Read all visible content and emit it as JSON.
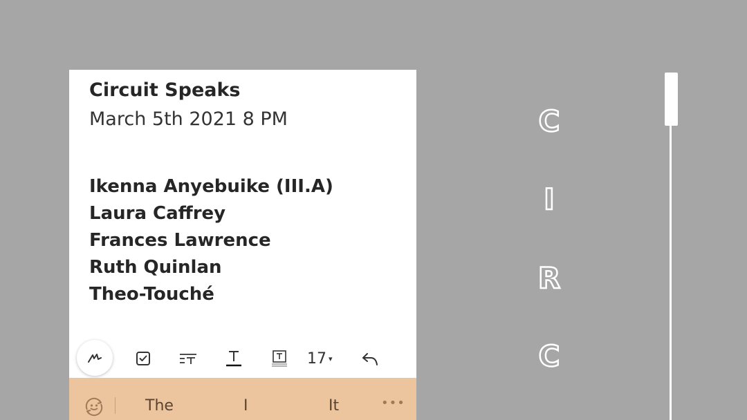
{
  "note": {
    "title": "Circuit Speaks",
    "date": "March 5th 2021 8 PM",
    "names": [
      "Ikenna Anyebuike (III.A)",
      "Laura Caffrey",
      "Frances Lawrence",
      "Ruth Quinlan",
      "Theo-Touché"
    ]
  },
  "toolbar": {
    "tools": [
      "pen-icon",
      "checkbox-icon",
      "text-style-icon",
      "underline-text-icon",
      "text-box-icon",
      "undo-icon"
    ],
    "font_size": "17",
    "font_size_caret": "▾"
  },
  "suggestions": {
    "emoji_icon": "emoji-icon",
    "words": [
      "The",
      "I",
      "It"
    ],
    "more": "•••"
  },
  "side_letters": [
    "C",
    "I",
    "R",
    "C"
  ],
  "colors": {
    "background": "#a6a6a6",
    "card": "#ffffff",
    "suggest_bar": "#ecc59f",
    "text": "#262626"
  }
}
